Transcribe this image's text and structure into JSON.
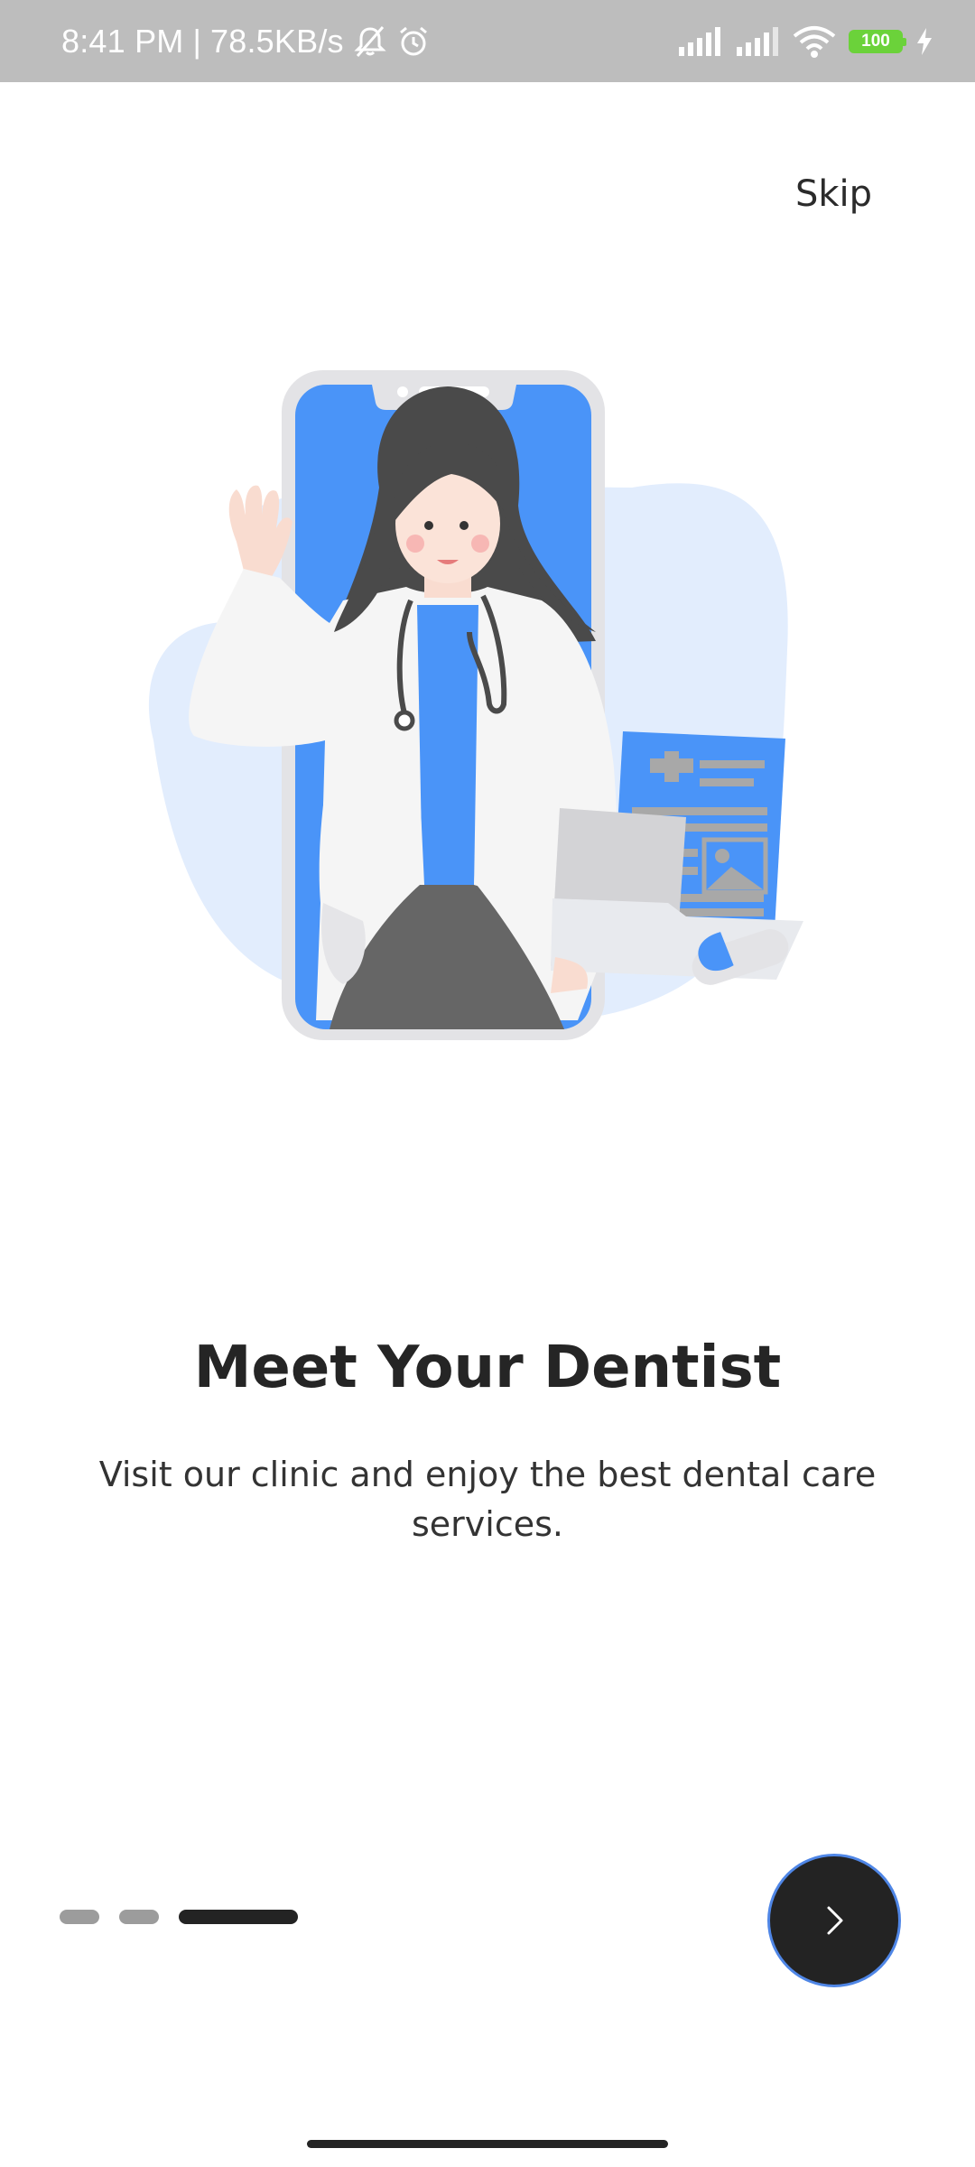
{
  "status_bar": {
    "time": "8:41 PM",
    "separator": "|",
    "network_speed": "78.5KB/s",
    "battery_level": "100",
    "icons": [
      "bell-muted-icon",
      "alarm-icon",
      "signal-icon",
      "signal-icon",
      "wifi-icon",
      "battery-icon",
      "charging-icon"
    ]
  },
  "onboarding": {
    "skip_label": "Skip",
    "title": "Meet Your Dentist",
    "subtitle": "Visit our clinic and enjoy the best dental care services.",
    "page_index": 3,
    "page_count": 3,
    "next_icon": "chevron-right-icon"
  },
  "colors": {
    "accent_blue": "#4a94f8",
    "dark": "#232323",
    "blob": "#e2edfd",
    "status_bar": "#bdbdbd"
  }
}
